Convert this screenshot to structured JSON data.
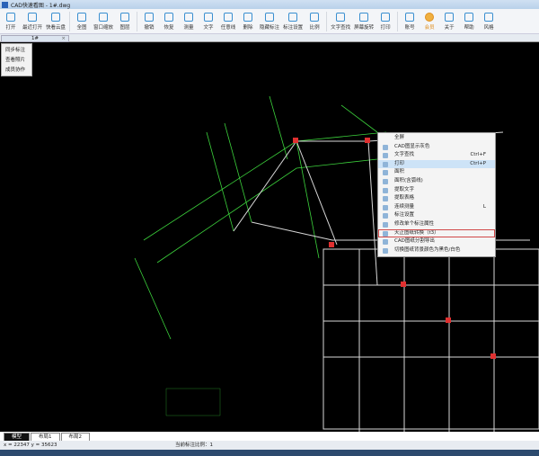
{
  "window": {
    "title": "CAD快速看图 - 1#.dwg"
  },
  "toolbar": [
    {
      "label": "打开",
      "icon": "folder-icon"
    },
    {
      "label": "最近打开",
      "icon": "clock-icon"
    },
    {
      "label": "快看云盘",
      "icon": "cloud-icon"
    },
    {
      "label": "全图",
      "icon": "fit-icon"
    },
    {
      "label": "窗口缩放",
      "icon": "zoom-window-icon"
    },
    {
      "label": "图层",
      "icon": "layers-icon"
    },
    {
      "label": "撤销",
      "icon": "undo-icon"
    },
    {
      "label": "恢复",
      "icon": "redo-icon"
    },
    {
      "label": "测量",
      "icon": "measure-icon"
    },
    {
      "label": "文字",
      "icon": "text-icon"
    },
    {
      "label": "任意线",
      "icon": "pen-icon"
    },
    {
      "label": "删除",
      "icon": "eraser-icon"
    },
    {
      "label": "隐藏标注",
      "icon": "eye-off-icon"
    },
    {
      "label": "标注设置",
      "icon": "annotation-settings-icon"
    },
    {
      "label": "比例",
      "icon": "scale-icon"
    },
    {
      "label": "文字查找",
      "icon": "text-search-icon"
    },
    {
      "label": "屏幕旋转",
      "icon": "rotate-icon"
    },
    {
      "label": "打印",
      "icon": "printer-icon"
    },
    {
      "label": "账号",
      "icon": "user-icon"
    },
    {
      "label": "会员",
      "icon": "vip-icon"
    },
    {
      "label": "关于",
      "icon": "info-icon"
    },
    {
      "label": "帮助",
      "icon": "help-icon"
    },
    {
      "label": "风格",
      "icon": "style-icon"
    }
  ],
  "doc_tab": {
    "label": "1#",
    "close": "×"
  },
  "dropdown": [
    "同步标注",
    "查看照片",
    "成员协作"
  ],
  "context_menu": [
    {
      "label": "全屏",
      "shortcut": ""
    },
    {
      "label": "CAD图显示灰色",
      "shortcut": ""
    },
    {
      "label": "文字查找",
      "shortcut": "Ctrl+F"
    },
    {
      "label": "打印",
      "shortcut": "Ctrl+P"
    },
    {
      "label": "面积",
      "shortcut": ""
    },
    {
      "label": "面积(含弧线)",
      "shortcut": ""
    },
    {
      "label": "提取文字",
      "shortcut": ""
    },
    {
      "label": "提取表格",
      "shortcut": ""
    },
    {
      "label": "连续测量",
      "shortcut": "L"
    },
    {
      "label": "标注设置",
      "shortcut": ""
    },
    {
      "label": "修改单个标注属性",
      "shortcut": ""
    },
    {
      "label": "天正图纸转换（t3）",
      "shortcut": ""
    },
    {
      "label": "CAD图纸分割导出",
      "shortcut": ""
    },
    {
      "label": "切换图纸背景颜色为黑色/白色",
      "shortcut": ""
    }
  ],
  "context_menu_highlight": "打印",
  "context_menu_boxed": "天正图纸转换（t3）",
  "layout_tabs": [
    "模型",
    "布局1",
    "布局2"
  ],
  "status": {
    "coords": "x = 22347  y = 35623",
    "scale": "当前标注比例：1"
  },
  "colors": {
    "canvas": "#000000",
    "cad_green": "#3cd23c",
    "cad_white": "#e0e0e0",
    "cad_red": "#e03030",
    "highlight_box": "#d04848"
  }
}
